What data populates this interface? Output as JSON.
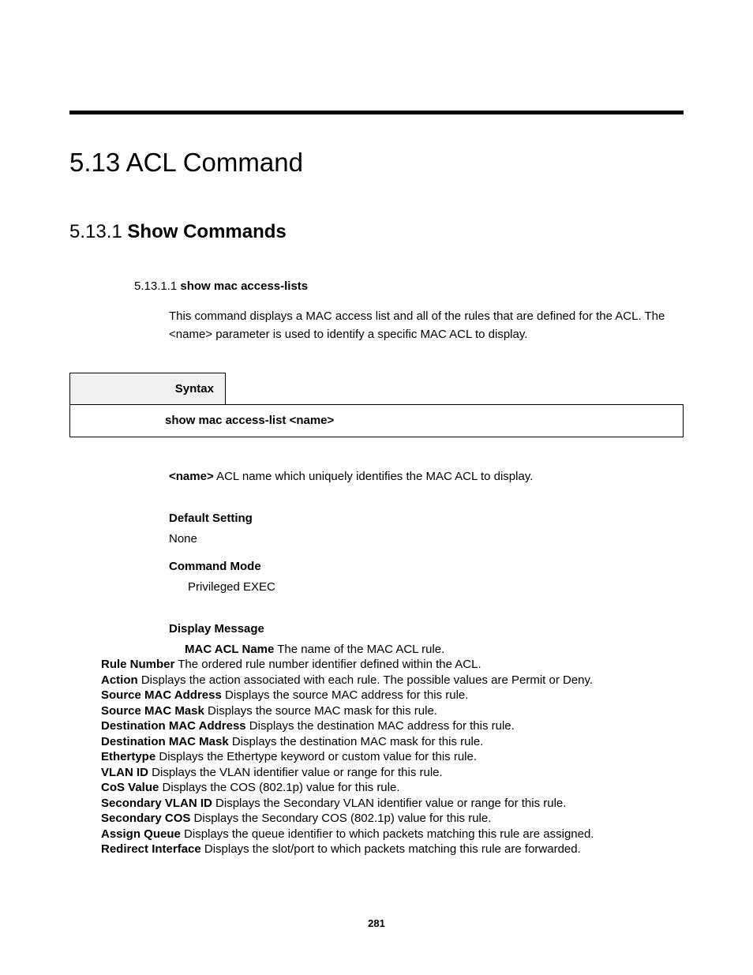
{
  "heading_main": "5.13 ACL Command",
  "heading_sub_num": "5.13.1 ",
  "heading_sub_text": "Show Commands",
  "heading_cmd_num": "5.13.1.1 ",
  "heading_cmd_text": "show mac access-lists",
  "desc_line1": "This command displays a MAC access list and all of the rules that are defined for the ACL. The",
  "desc_line2": "<name> parameter is used to identify a specific MAC ACL to display.",
  "syntax_label": "Syntax",
  "syntax_body": "show mac access-list <name>",
  "name_param_b": "<name>",
  "name_param_t": " ACL name which uniquely identifies the MAC ACL to display.",
  "default_setting_label": "Default Setting",
  "default_setting_value": "None",
  "command_mode_label": "Command Mode",
  "command_mode_value": "Privileged EXEC",
  "display_message_label": "Display Message",
  "msgs": [
    {
      "b": "MAC ACL Name",
      "t": " The name of the MAC ACL rule."
    },
    {
      "b": "Rule Number",
      "t": " The ordered rule number identifier defined within the ACL."
    },
    {
      "b": "Action",
      "t": " Displays the action associated with each rule. The possible values are Permit or Deny."
    },
    {
      "b": "Source MAC Address",
      "t": " Displays the source MAC address for this rule."
    },
    {
      "b": "Source MAC Mask",
      "t": " Displays the source MAC mask for this rule."
    },
    {
      "b": "Destination MAC Address",
      "t": " Displays the destination MAC address for this rule."
    },
    {
      "b": "Destination MAC Mask",
      "t": " Displays the destination MAC mask for this rule."
    },
    {
      "b": "Ethertype",
      "t": " Displays the Ethertype keyword or custom value for this rule."
    },
    {
      "b": "VLAN ID",
      "t": " Displays the VLAN identifier value or range for this rule."
    },
    {
      "b": "CoS Value",
      "t": " Displays the COS (802.1p) value for this rule."
    },
    {
      "b": "Secondary VLAN ID",
      "t": " Displays the Secondary VLAN identifier value or range for this rule."
    },
    {
      "b": "Secondary COS",
      "t": " Displays the Secondary COS (802.1p) value for this rule."
    },
    {
      "b": "Assign Queue",
      "t": " Displays the queue identifier to which packets matching this rule are assigned."
    },
    {
      "b": "Redirect Interface",
      "t": " Displays the slot/port to which packets matching this rule are forwarded."
    }
  ],
  "page_number": "281"
}
